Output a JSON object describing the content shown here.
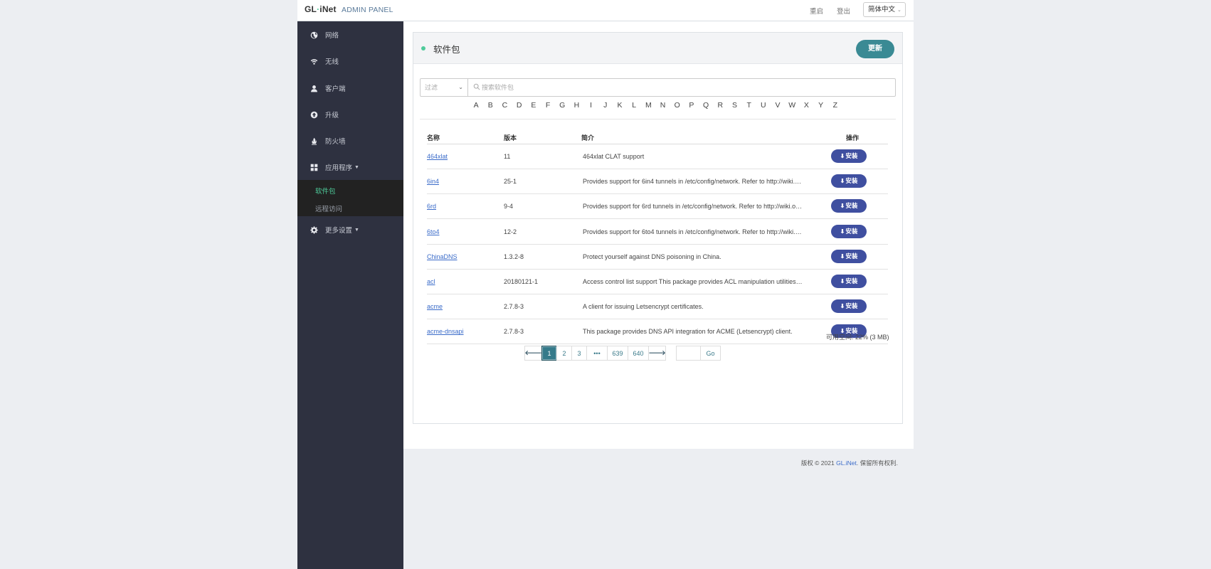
{
  "header": {
    "logo": "GL·iNet",
    "logo_prefix": "GL",
    "logo_dot": "·",
    "logo_suffix": "iNet",
    "panel_label": "ADMIN PANEL",
    "reboot_label": "重启",
    "logout_label": "登出",
    "language": "简体中文"
  },
  "sidebar": {
    "items": [
      {
        "label": "网络",
        "icon": "globe-icon"
      },
      {
        "label": "无线",
        "icon": "wifi-icon"
      },
      {
        "label": "客户端",
        "icon": "user-icon"
      },
      {
        "label": "升级",
        "icon": "upgrade-icon"
      },
      {
        "label": "防火墙",
        "icon": "fire-icon"
      },
      {
        "label": "应用程序",
        "icon": "apps-icon"
      },
      {
        "label": "更多设置",
        "icon": "gear-icon"
      }
    ],
    "submenu": [
      {
        "label": "软件包",
        "active": true
      },
      {
        "label": "远程访问",
        "active": false
      }
    ]
  },
  "main": {
    "title": "软件包",
    "update_label": "更新",
    "filter_label": "过滤",
    "search_placeholder": "搜索软件包",
    "letters": [
      "A",
      "B",
      "C",
      "D",
      "E",
      "F",
      "G",
      "H",
      "I",
      "J",
      "K",
      "L",
      "M",
      "N",
      "O",
      "P",
      "Q",
      "R",
      "S",
      "T",
      "U",
      "V",
      "W",
      "X",
      "Y",
      "Z"
    ],
    "columns": {
      "name": "名称",
      "version": "版本",
      "description": "简介",
      "action": "操作"
    },
    "install_label": "安装",
    "packages": [
      {
        "name": "464xlat",
        "version": "11",
        "description": "464xlat CLAT support"
      },
      {
        "name": "6in4",
        "version": "25-1",
        "description": "Provides support for 6in4 tunnels in /etc/config/network. Refer to http://wiki.o..."
      },
      {
        "name": "6rd",
        "version": "9-4",
        "description": "Provides support for 6rd tunnels in /etc/config/network. Refer to http://wiki.op..."
      },
      {
        "name": "6to4",
        "version": "12-2",
        "description": "Provides support for 6to4 tunnels in /etc/config/network. Refer to http://wiki.o..."
      },
      {
        "name": "ChinaDNS",
        "version": "1.3.2-8",
        "description": "Protect yourself against DNS poisoning in China."
      },
      {
        "name": "acl",
        "version": "20180121-1",
        "description": "Access control list support This package provides ACL manipulation utilities c..."
      },
      {
        "name": "acme",
        "version": "2.7.8-3",
        "description": "A client for issuing Letsencrypt certificates."
      },
      {
        "name": "acme-dnsapi",
        "version": "2.7.8-3",
        "description": "This package provides DNS API integration for ACME (Letsencrypt) client."
      }
    ],
    "free_space": "可用空间: 22% (3 MB)",
    "pagination": {
      "prev": "🡐",
      "pages": [
        "1",
        "2",
        "3",
        "•••",
        "639",
        "640"
      ],
      "next": "🡒",
      "current": "1",
      "go_label": "Go"
    }
  },
  "footer": {
    "prefix": "版权 © 2021 ",
    "brand": "GL.iNet",
    "suffix": ". 保留所有权利."
  }
}
